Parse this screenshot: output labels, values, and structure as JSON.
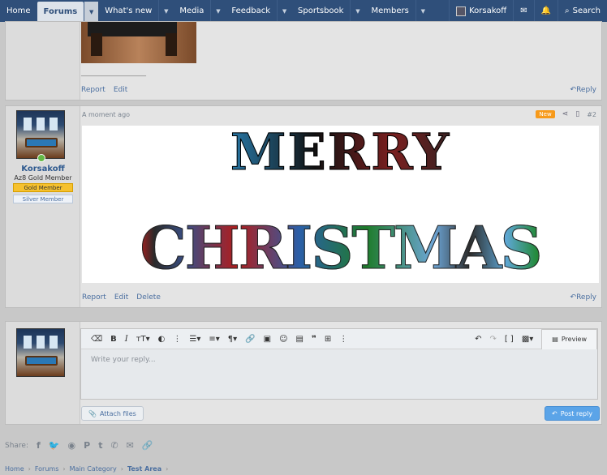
{
  "nav": {
    "items": [
      {
        "label": "Home",
        "active": false,
        "dropdown": false
      },
      {
        "label": "Forums",
        "active": true,
        "dropdown": true
      },
      {
        "label": "What's new",
        "active": false,
        "dropdown": true
      },
      {
        "label": "Media",
        "active": false,
        "dropdown": true
      },
      {
        "label": "Feedback",
        "active": false,
        "dropdown": true
      },
      {
        "label": "Sportsbook",
        "active": false,
        "dropdown": true
      },
      {
        "label": "Members",
        "active": false,
        "dropdown": true
      }
    ],
    "username": "Korsakoff",
    "search_label": "Search",
    "bg_color": "#2f4f7a"
  },
  "post1": {
    "signature_line": "____________________",
    "actions": {
      "report": "Report",
      "edit": "Edit"
    },
    "reply": "Reply"
  },
  "post2": {
    "username": "Korsakoff",
    "user_title": "Az8 Gold Member",
    "badge_gold": "Gold Member",
    "badge_silver": "Silver Member",
    "time": "A moment ago",
    "new_badge": "New",
    "post_number": "#2",
    "art_line1": "MERRY",
    "art_line2": "CHRISTMAS",
    "actions": {
      "report": "Report",
      "edit": "Edit",
      "delete": "Delete"
    },
    "reply": "Reply"
  },
  "editor": {
    "placeholder": "Write your reply...",
    "preview": "Preview",
    "attach": "Attach files",
    "post_reply": "Post reply"
  },
  "share": {
    "label": "Share:"
  },
  "breadcrumb": [
    "Home",
    "Forums",
    "Main Category",
    "Test Area"
  ]
}
